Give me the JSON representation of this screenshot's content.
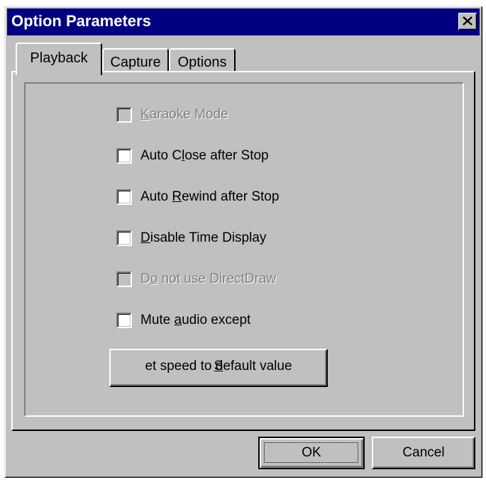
{
  "window": {
    "title": "Option Parameters"
  },
  "tabs": [
    {
      "label": "Playback",
      "active": true
    },
    {
      "label": "Capture",
      "active": false
    },
    {
      "label": "Options",
      "active": false
    }
  ],
  "playback": {
    "checkboxes": [
      {
        "pre": "",
        "mnemonic": "K",
        "post": "araoke Mode",
        "checked": false,
        "enabled": false
      },
      {
        "pre": "Auto C",
        "mnemonic": "l",
        "post": "ose after Stop",
        "checked": false,
        "enabled": true
      },
      {
        "pre": "Auto ",
        "mnemonic": "R",
        "post": "ewind after Stop",
        "checked": false,
        "enabled": true
      },
      {
        "pre": "",
        "mnemonic": "D",
        "post": "isable Time Display",
        "checked": false,
        "enabled": true
      },
      {
        "pre": "D",
        "mnemonic": "o",
        "post": " not use DirectDraw",
        "checked": false,
        "enabled": false
      },
      {
        "pre": "Mute ",
        "mnemonic": "a",
        "post": "udio except",
        "checked": false,
        "enabled": true
      }
    ],
    "default_speed_button": {
      "pre": "",
      "mnemonic": "S",
      "post": "et speed to default value"
    }
  },
  "footer": {
    "ok_label": "OK",
    "cancel_label": "Cancel"
  },
  "colors": {
    "face": "#c0c0c0",
    "titlebar": "#000080",
    "disabled_text": "#808080"
  }
}
